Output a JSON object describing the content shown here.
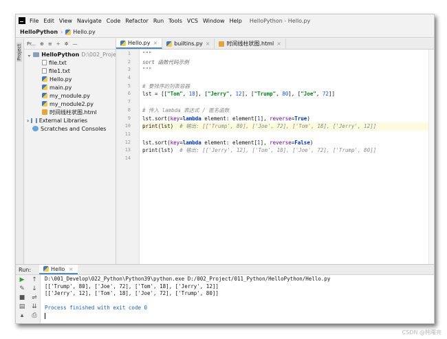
{
  "menubar": {
    "items": [
      "File",
      "Edit",
      "View",
      "Navigate",
      "Code",
      "Refactor",
      "Run",
      "Tools",
      "VCS",
      "Window",
      "Help"
    ],
    "title": "HelloPython - Hello.py"
  },
  "breadcrumb": {
    "project": "HelloPython",
    "file": "Hello.py"
  },
  "project_panel": {
    "toolbar_label": "Pr...",
    "strip_label": "Project",
    "tree": [
      {
        "label": "HelloPython",
        "path": "D:\\002_Projec",
        "kind": "folder"
      },
      {
        "label": "file.txt",
        "kind": "txt"
      },
      {
        "label": "file1.txt",
        "kind": "txt"
      },
      {
        "label": "Hello.py",
        "kind": "py"
      },
      {
        "label": "main.py",
        "kind": "py"
      },
      {
        "label": "my_module.py",
        "kind": "py"
      },
      {
        "label": "my_module2.py",
        "kind": "py"
      },
      {
        "label": "时间线柱状图.html",
        "kind": "html"
      },
      {
        "label": "External Libraries",
        "kind": "lib"
      },
      {
        "label": "Scratches and Consoles",
        "kind": "scratch"
      }
    ]
  },
  "tabs": [
    {
      "label": "Hello.py",
      "kind": "py",
      "active": true
    },
    {
      "label": "builtins.py",
      "kind": "py",
      "active": false
    },
    {
      "label": "时间线柱状图.html",
      "kind": "html",
      "active": false
    }
  ],
  "editor": {
    "line_numbers": [
      "1",
      "2",
      "3",
      "4",
      "5",
      "6",
      "7",
      "8",
      "9",
      "10",
      "11",
      "12",
      "13",
      "14"
    ],
    "highlighted_line": 10,
    "lines": [
      "\"\"\"",
      "sort 函数代码示例",
      "\"\"\"",
      "",
      "# 要排序的列表容器",
      "lst = [[\"Tom\", 18], [\"Jerry\", 12], [\"Trump\", 80], [\"Joe\", 72]]",
      "",
      "# 传入 lambda 表达式 / 匿名函数",
      "lst.sort(key=lambda element: element[1], reverse=True)",
      "print(lst)  # 输出: [['Trump', 80], ['Joe', 72], ['Tom', 18], ['Jerry', 12]]",
      "",
      "lst.sort(key=lambda element: element[1], reverse=False)",
      "print(lst)  # 输出: [['Jerry', 12], ['Tom', 18], ['Joe', 72], ['Trump', 80]]",
      ""
    ]
  },
  "run_panel": {
    "label": "Run:",
    "tab": "Hello",
    "console": [
      "D:\\001_Develop\\022_Python\\Python39\\python.exe D:/002_Project/011_Python/HelloPython/Hello.py",
      "[['Trump', 80], ['Joe', 72], ['Tom', 18], ['Jerry', 12]]",
      "[['Jerry', 12], ['Tom', 18], ['Joe', 72], ['Trump', 80]]",
      "",
      "Process finished with exit code 0"
    ]
  },
  "watermark": "CSDN @韩曙亮"
}
